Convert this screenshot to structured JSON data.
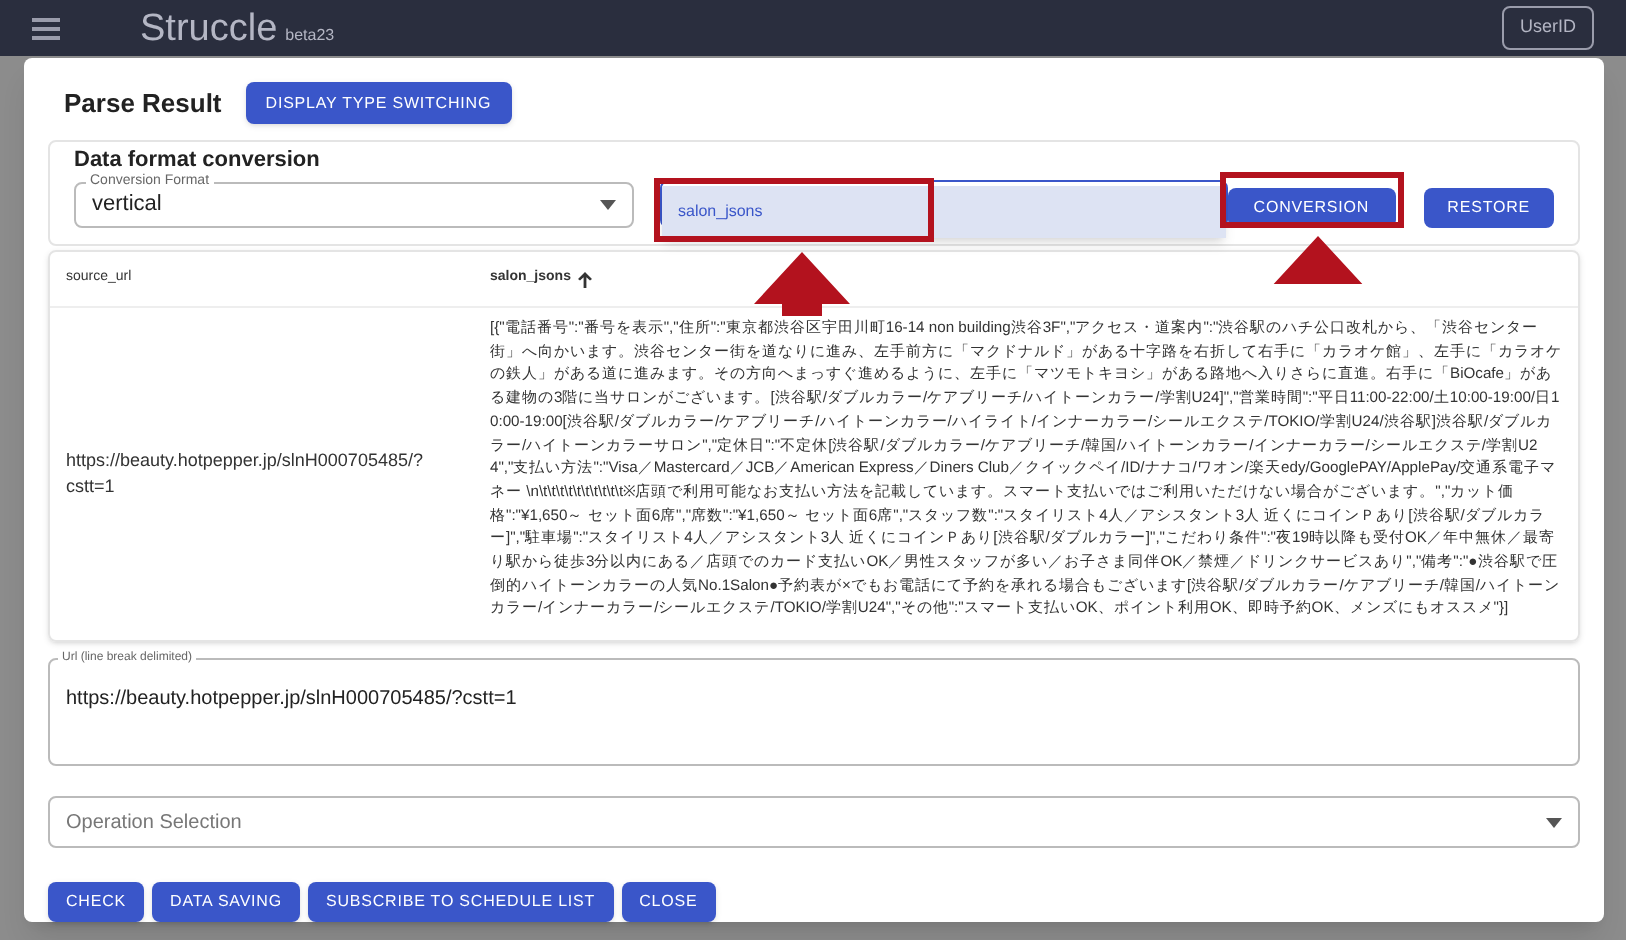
{
  "app_bar": {
    "title": "Struccle",
    "version": "beta23",
    "user_button": "UserID"
  },
  "dialog": {
    "title": "Parse Result",
    "display_button": "DISPLAY TYPE SWITCHING",
    "conversion": {
      "heading": "Data format conversion",
      "format_field": {
        "label": "Conversion Format",
        "value": "vertical"
      },
      "column_options": [
        {
          "label": "salon_jsons",
          "selected": true,
          "highlighted": true
        }
      ],
      "buttons": [
        {
          "label": "CONVERSION",
          "highlighted": true
        },
        {
          "label": "RESTORE",
          "highlighted": false
        }
      ]
    },
    "table": {
      "columns": [
        {
          "label": "source_url",
          "sorted": false
        },
        {
          "label": "salon_jsons",
          "sorted": true
        }
      ],
      "rows": [
        [
          "https://beauty.hotpepper.jp/slnH000705485/?cstt=1",
          "[{\"電話番号\":\"番号を表示\",\"住所\":\"東京都渋谷区宇田川町16-14 non building渋谷3F\",\"アクセス・道案内\":\"渋谷駅のハチ公口改札から、「渋谷センター街」へ向かいます。渋谷センター街を道なりに進み、左手前方に「マクドナルド」がある十字路を右折して右手に「カラオケ館」、左手に「カラオケの鉄人」がある道に進みます。その方向へまっすぐ進めるように、左手に「マツモトキヨシ」がある路地へ入りさらに直進。右手に「BiOcafe」がある建物の3階に当サロンがございます。[渋谷駅/ダブルカラー/ケアブリーチ/ハイトーンカラー/学割U24]\",\"営業時間\":\"平日11:00-22:00/土10:00-19:00/日10:00-19:00[渋谷駅/ダブルカラー/ケアブリーチ/ハイトーンカラー/ハイライト/インナーカラー/シールエクステ/TOKIO/学割U24/渋谷駅]渋谷駅/ダブルカラー/ハイトーンカラーサロン\",\"定休日\":\"不定休[渋谷駅/ダブルカラー/ケアブリーチ/韓国/ハイトーンカラー/インナーカラー/シールエクステ/学割U24\",\"支払い方法\":\"Visa／Mastercard／JCB／American Express／Diners Club／クイックペイ/ID/ナナコ/ワオン/楽天edy/GooglePAY/ApplePay/交通系電子マネー \\n\\t\\t\\t\\t\\t\\t\\t\\t\\t\\t※店頭で利用可能なお支払い方法を記載しています。スマート支払いではご利用いただけない場合がございます。\",\"カット価格\":\"¥1,650～ セット面6席\",\"席数\":\"¥1,650～ セット面6席\",\"スタッフ数\":\"スタイリスト4人／アシスタント3人 近くにコインＰあり[渋谷駅/ダブルカラー]\",\"駐車場\":\"スタイリスト4人／アシスタント3人 近くにコインＰあり[渋谷駅/ダブルカラー]\",\"こだわり条件\":\"夜19時以降も受付OK／年中無休／最寄り駅から徒歩3分以内にある／店頭でのカード支払いOK／男性スタッフが多い／お子さま同伴OK／禁煙／ドリンクサービスあり\",\"備考\":\"●渋谷駅で圧倒的ハイトーンカラーの人気No.1Salon●予約表が×でもお電話にて予約を承れる場合もございます[渋谷駅/ダブルカラー/ケアブリーチ/韓国/ハイトーンカラー/インナーカラー/シールエクステ/TOKIO/学割U24\",\"その他\":\"スマート支払いOK、ポイント利用OK、即時予約OK、メンズにもオススメ\"}]"
        ]
      ]
    },
    "url_field": {
      "label": "Url (line break delimited)",
      "value": "https://beauty.hotpepper.jp/slnH000705485/?cstt=1"
    },
    "operation_field": {
      "placeholder": "Operation Selection"
    },
    "buttons": [
      "CHECK",
      "DATA SAVING",
      "SUBSCRIBE TO SCHEDULE LIST",
      "CLOSE"
    ]
  }
}
